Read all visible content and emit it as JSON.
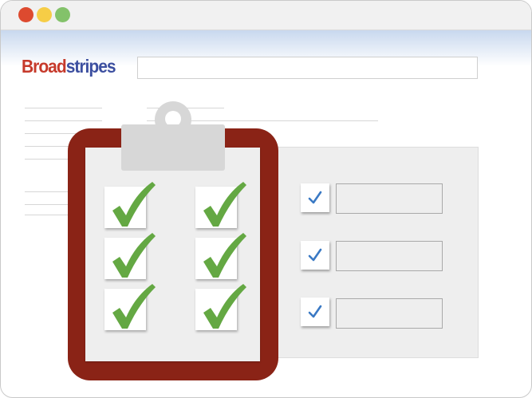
{
  "window": {
    "controls": [
      "close",
      "minimize",
      "maximize"
    ]
  },
  "header": {
    "logo_part1": "Broad",
    "logo_part2": "stripes",
    "search_value": ""
  },
  "colors": {
    "logo_red": "#c63a2b",
    "logo_blue": "#3c4fa0",
    "clipboard": "#8a2316",
    "green_check": "#64a843",
    "blue_check": "#3a79c4"
  },
  "illustration": {
    "clipboard_checks": 6,
    "form_rows": [
      {
        "checked": true,
        "field_value": ""
      },
      {
        "checked": true,
        "field_value": ""
      },
      {
        "checked": true,
        "field_value": ""
      }
    ]
  },
  "icons": [
    "clipboard-icon",
    "green-checkmark-icon",
    "blue-checkmark-icon"
  ]
}
